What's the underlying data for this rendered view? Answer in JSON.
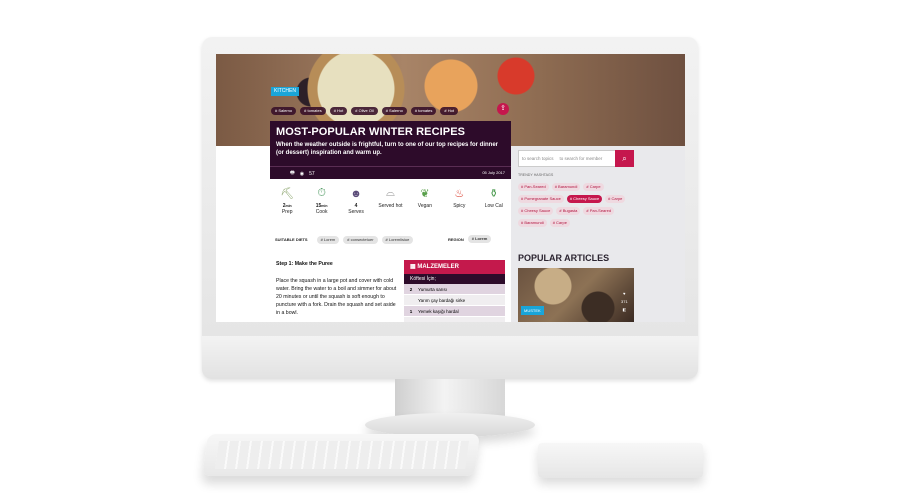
{
  "hero": {
    "badge": "KITCHEN",
    "tags": [
      "# Salerno",
      "# tomates",
      "# Hot",
      "# Olive Oil",
      "# Salerno",
      "# tomates",
      "# Hot"
    ],
    "title": "MOST-POPULAR WINTER RECIPES",
    "subtitle": "When the weather outside is frightful, turn to one of our top recipes for dinner (or dessert) inspiration and warm up.",
    "view_count": "57",
    "date": "05 July 2017"
  },
  "icons": [
    {
      "name": "prep-icon",
      "num": "2",
      "unit": "min",
      "label": "Prep",
      "color": "#8aa36b",
      "glyph": "⛏"
    },
    {
      "name": "timer-icon",
      "num": "15",
      "unit": "min",
      "label": "Cook",
      "color": "#5aa06c",
      "glyph": "⏱"
    },
    {
      "name": "people-icon",
      "num": "4",
      "unit": "",
      "label": "Serves",
      "color": "#5a4b78",
      "glyph": "☻"
    },
    {
      "name": "dome-icon",
      "num": "",
      "unit": "",
      "label": "Served hot",
      "color": "#8c8c8c",
      "glyph": "⌓"
    },
    {
      "name": "leaf-icon",
      "num": "",
      "unit": "",
      "label": "Vegan",
      "color": "#5aa04c",
      "glyph": "❦"
    },
    {
      "name": "chili-icon",
      "num": "",
      "unit": "",
      "label": "Spicy",
      "color": "#d83a2b",
      "glyph": "♨"
    },
    {
      "name": "jar-icon",
      "num": "",
      "unit": "",
      "label": "Low Cal",
      "color": "#4a9a4e",
      "glyph": "⚱"
    }
  ],
  "diets": {
    "label": "SUITABLE DIETS",
    "items": [
      "# Lorem",
      "# consectetuer",
      "# Loremlisiue"
    ],
    "region_label": "REGION",
    "region": "# Lorem"
  },
  "step": {
    "heading": "Step 1: Make the Puree",
    "text": "Place the squash in a large pot and cover with cold water. Bring the water to a boil and simmer for about 20 minutes or until the squash is soft enough to puncture with a fork. Drain the squash and set aside in a bowl."
  },
  "ingredients": {
    "title": "MALZEMELER",
    "section": "Köftesi İçin;",
    "rows": [
      {
        "q": "2",
        "t": "Yumurta sarısı"
      },
      {
        "q": "",
        "t": "Yarım çay bardağı sirke"
      },
      {
        "q": "1",
        "t": "Yemek kaşığı hardal"
      }
    ]
  },
  "sidebar": {
    "search_placeholder_topics": "to search topics",
    "search_placeholder_member": "to search for member",
    "trending_label": "TRENDY HASHTAGS",
    "hashtags": [
      "# Pan-Seared",
      "# Baramundi",
      "# Carpe",
      "# Pomegranate Sauce",
      "# Cheesy Sauce",
      "# Carpe",
      "# Cheesy Sauce",
      "# Bugasta",
      "# Pan-Seared",
      "# Baramundi",
      "# Carpe"
    ],
    "active_hashtag_index": 4,
    "popular_title": "POPULAR ARTICLES",
    "popular_badge": "MUSTEK",
    "popular_count": "371"
  }
}
